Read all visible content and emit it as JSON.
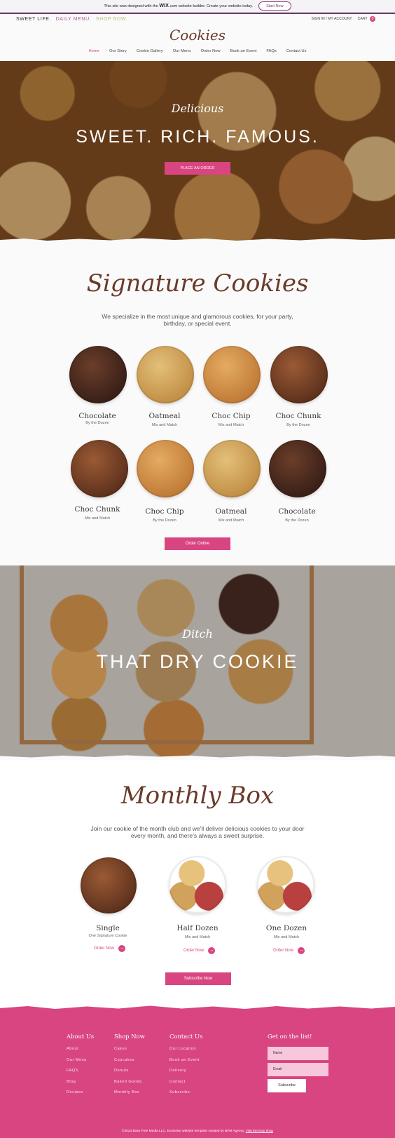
{
  "wix_banner": {
    "text_before": "This site was designed with the",
    "brand": "WIX",
    "text_after": ".com website builder. Create your website today.",
    "cta": "Start Now"
  },
  "header": {
    "tagline_1": "SWEET LIFE.",
    "tagline_2": "DAILY MENU.",
    "tagline_3": "SHOP NOW.",
    "account": "SIGN IN / MY ACCOUNT",
    "cart_label": "CART",
    "cart_count": "0",
    "logo": "Cookies",
    "nav": [
      "Home",
      "Our Story",
      "Cookie Gallery",
      "Our Menu",
      "Order Now",
      "Book an Event",
      "FAQs",
      "Contact Us"
    ]
  },
  "hero": {
    "kicker": "Delicious",
    "title": "SWEET. RICH. FAMOUS.",
    "button": "PLACE AN ORDER"
  },
  "signature": {
    "title": "Signature Cookies",
    "description": "We specialize in the most unique and glamorous cookies, for your party, birthday, or special event.",
    "cookies": [
      {
        "name": "Chocolate",
        "sub": "By the Dozen"
      },
      {
        "name": "Oatmeal",
        "sub": "Mix and Match"
      },
      {
        "name": "Choc Chip",
        "sub": "Mix and Match"
      },
      {
        "name": "Choc Chunk",
        "sub": "By the Dozen"
      },
      {
        "name": "Choc Chunk",
        "sub": "Mix and Match"
      },
      {
        "name": "Choc Chip",
        "sub": "By the Dozen"
      },
      {
        "name": "Oatmeal",
        "sub": "Mix and Match"
      },
      {
        "name": "Chocolate",
        "sub": "By the Dozen"
      }
    ],
    "button": "Order Online"
  },
  "box_banner": {
    "kicker": "Ditch",
    "title": "THAT DRY COOKIE"
  },
  "monthly": {
    "title": "Monthly Box",
    "description": "Join our cookie of the month club and we'll deliver delicious cookies to your door every month, and there's always a sweet surprise.",
    "items": [
      {
        "name": "Single",
        "sub": "One Signature Cookie",
        "link": "Order Now"
      },
      {
        "name": "Half Dozen",
        "sub": "Mix and Match",
        "link": "Order Now"
      },
      {
        "name": "One Dozen",
        "sub": "Mix and Match",
        "link": "Order Now"
      }
    ],
    "button": "Subscribe Now"
  },
  "footer": {
    "about": {
      "title": "About Us",
      "items": [
        "About",
        "Our Menu",
        "FAQS",
        "Blog",
        "Recipes"
      ]
    },
    "shop": {
      "title": "Shop Now",
      "items": [
        "Cakes",
        "Cupcakes",
        "Donuts",
        "Baked Goods",
        "Monthly Box"
      ]
    },
    "contact": {
      "title": "Contact Us",
      "items": [
        "Our Location",
        "Book an Event",
        "Delivery",
        "Contact",
        "Subscribe"
      ]
    },
    "newsletter": {
      "title": "Get on the list!",
      "name_placeholder": "Name",
      "email_placeholder": "Email",
      "button": "Subscribe"
    },
    "copyright": "©2023 Boss Free Media LLC. Exclusive website template created by BFM Agency.",
    "copyright_link": "Visit the Etsy shop"
  },
  "colors": {
    "accent": "#d94580",
    "brown": "#6b3a2a",
    "banner_border": "#6d3a6a"
  }
}
